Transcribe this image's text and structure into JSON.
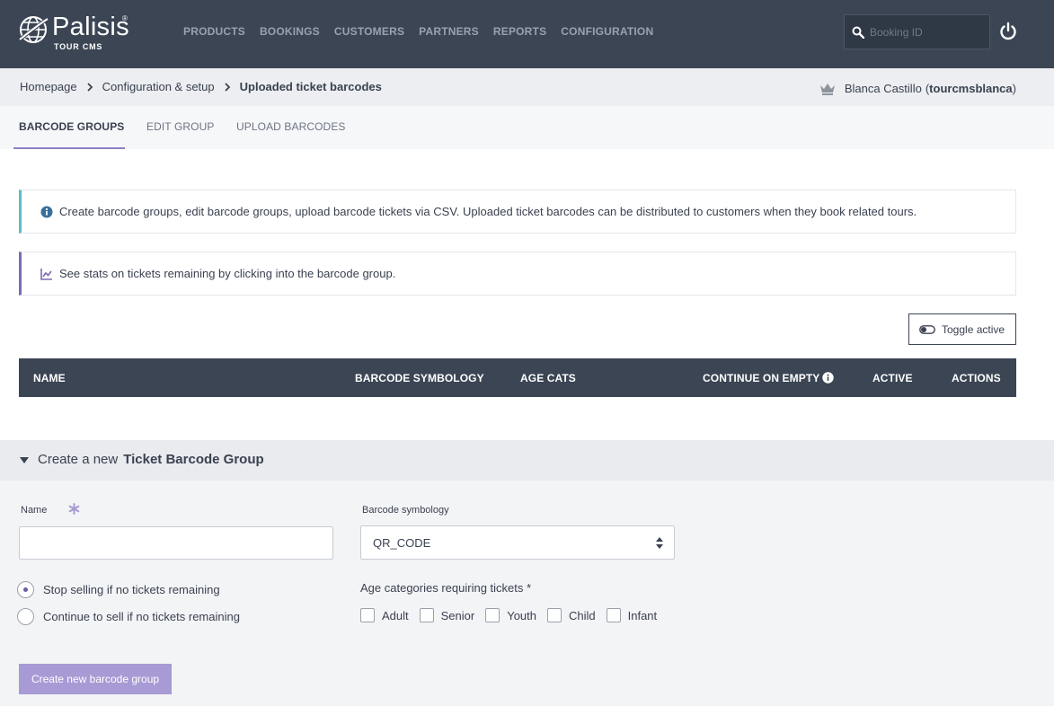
{
  "brand": {
    "name": "Palisis",
    "registered": "®",
    "subtitle": "TOUR CMS"
  },
  "nav": {
    "items": [
      "PRODUCTS",
      "BOOKINGS",
      "CUSTOMERS",
      "PARTNERS",
      "REPORTS",
      "CONFIGURATION"
    ]
  },
  "search": {
    "placeholder": "Booking ID",
    "value": ""
  },
  "breadcrumb": {
    "items": [
      "Homepage",
      "Configuration & setup",
      "Uploaded ticket barcodes"
    ]
  },
  "user": {
    "name": "Blanca Castillo",
    "username": "tourcmsblanca",
    "open": "(",
    "close": ")"
  },
  "tabs": [
    "BARCODE GROUPS",
    "EDIT GROUP",
    "UPLOAD BARCODES"
  ],
  "alerts": {
    "info": "Create barcode groups, edit barcode groups, upload barcode tickets via CSV. Uploaded ticket barcodes can be distributed to customers when they book related tours.",
    "stats": "See stats on tickets remaining by clicking into the barcode group."
  },
  "toggle_button": "Toggle active",
  "table": {
    "headers": [
      "NAME",
      "BARCODE SYMBOLOGY",
      "AGE CATS",
      "CONTINUE ON EMPTY",
      "ACTIVE",
      "ACTIONS"
    ]
  },
  "create": {
    "prefix": "Create a new",
    "title": "Ticket Barcode Group",
    "name_label": "Name",
    "name_value": "",
    "symbology_label": "Barcode symbology",
    "symbology_value": "QR_CODE",
    "radio_stop": "Stop selling if no tickets remaining",
    "radio_continue": "Continue to sell if no tickets remaining",
    "age_label": "Age categories requiring tickets *",
    "age_categories": [
      "Adult",
      "Senior",
      "Youth",
      "Child",
      "Infant"
    ],
    "submit": "Create new barcode group"
  },
  "colors": {
    "topbar": "#3b4554",
    "accent": "#8b7fc7",
    "info_border": "#5bbccb",
    "stats_border": "#7d6bb3",
    "button_primary": "#a89ad4"
  }
}
